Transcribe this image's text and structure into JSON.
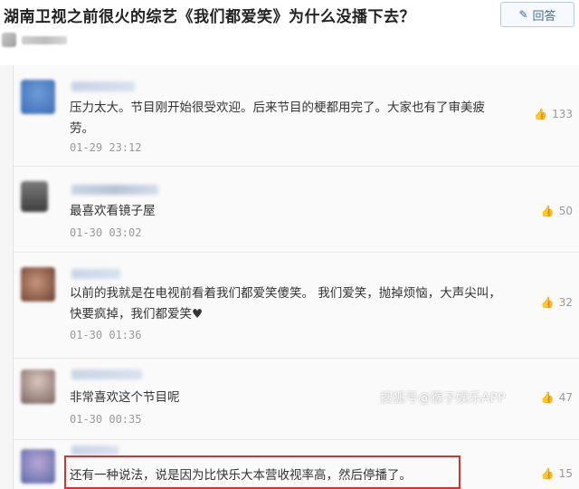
{
  "question": {
    "title": "湖南卫视之前很火的综艺《我们都爱笑》为什么没播下去？",
    "answer_button_label": "回答",
    "answer_button_icon": "pencil-icon"
  },
  "comments": [
    {
      "text": "压力太大。节目刚开始很受欢迎。后来节目的梗都用完了。大家也有了审美疲劳。",
      "time": "01-29 23:12",
      "likes": "133"
    },
    {
      "text": "最喜欢看镜子屋",
      "time": "01-30 03:02",
      "likes": "50"
    },
    {
      "text": "以前的我就是在电视前看着我们都爱笑傻笑。 我们爱笑，抛掉烦恼，大声尖叫，快要疯掉，我们都爱笑♥",
      "time": "01-30 01:36",
      "likes": "32"
    },
    {
      "text": "非常喜欢这个节目呢",
      "time": "01-30 00:35",
      "likes": "47"
    },
    {
      "text": "还有一种说法，说是因为比快乐大本营收视率高，然后停播了。",
      "time": "",
      "likes": "15"
    }
  ],
  "watermark": "搜狐号@猴子娱乐APP",
  "colors": {
    "highlight_border": "#d9312c",
    "answer_button_text": "#4a6a95",
    "timestamp": "#999999"
  }
}
